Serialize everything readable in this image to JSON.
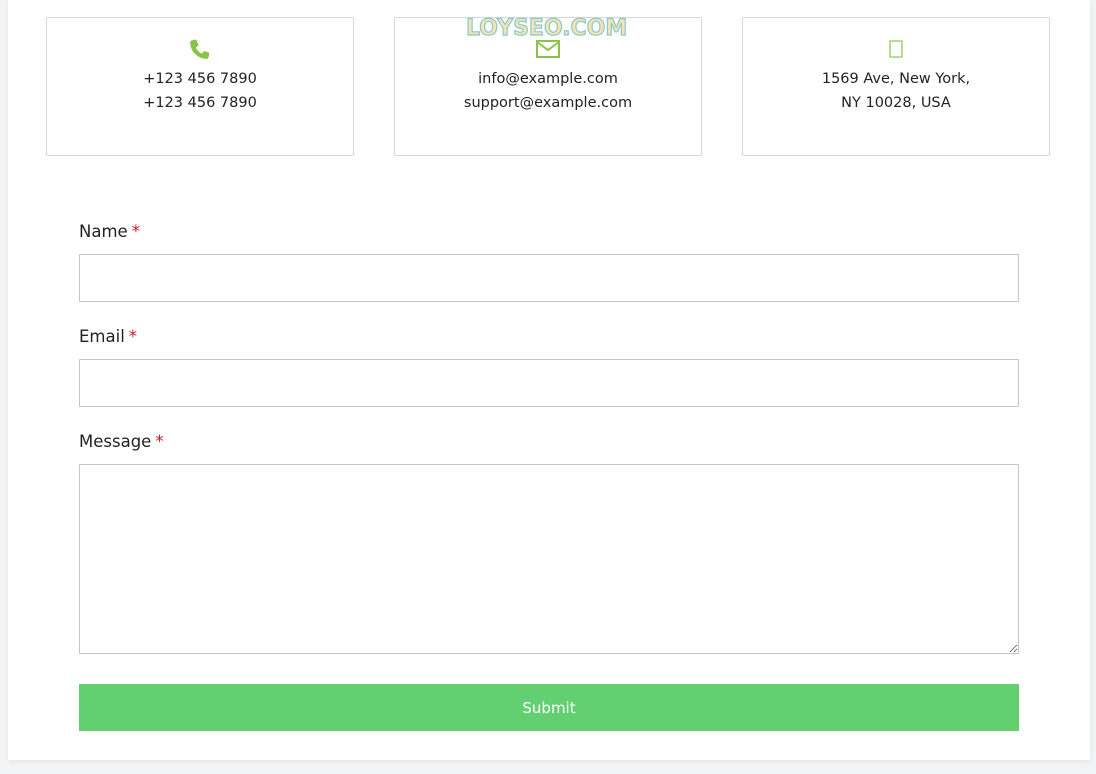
{
  "contact_cards": {
    "phone": {
      "icon": "phone-icon",
      "lines": [
        "+123 456 7890",
        "+123 456 7890"
      ]
    },
    "email": {
      "icon": "envelope-icon",
      "lines": [
        "info@example.com",
        "support@example.com"
      ]
    },
    "address": {
      "icon": "map-marker-icon",
      "lines": [
        "1569 Ave, New York,",
        "NY 10028, USA"
      ]
    }
  },
  "watermark": "LOYSEO.COM",
  "form": {
    "name_label": "Name",
    "email_label": "Email",
    "message_label": "Message",
    "required_marker": "*",
    "name_value": "",
    "email_value": "",
    "message_value": "",
    "submit_label": "Submit"
  },
  "colors": {
    "accent": "#8bc34a",
    "submit": "#62cf70",
    "required": "#cc1818"
  }
}
